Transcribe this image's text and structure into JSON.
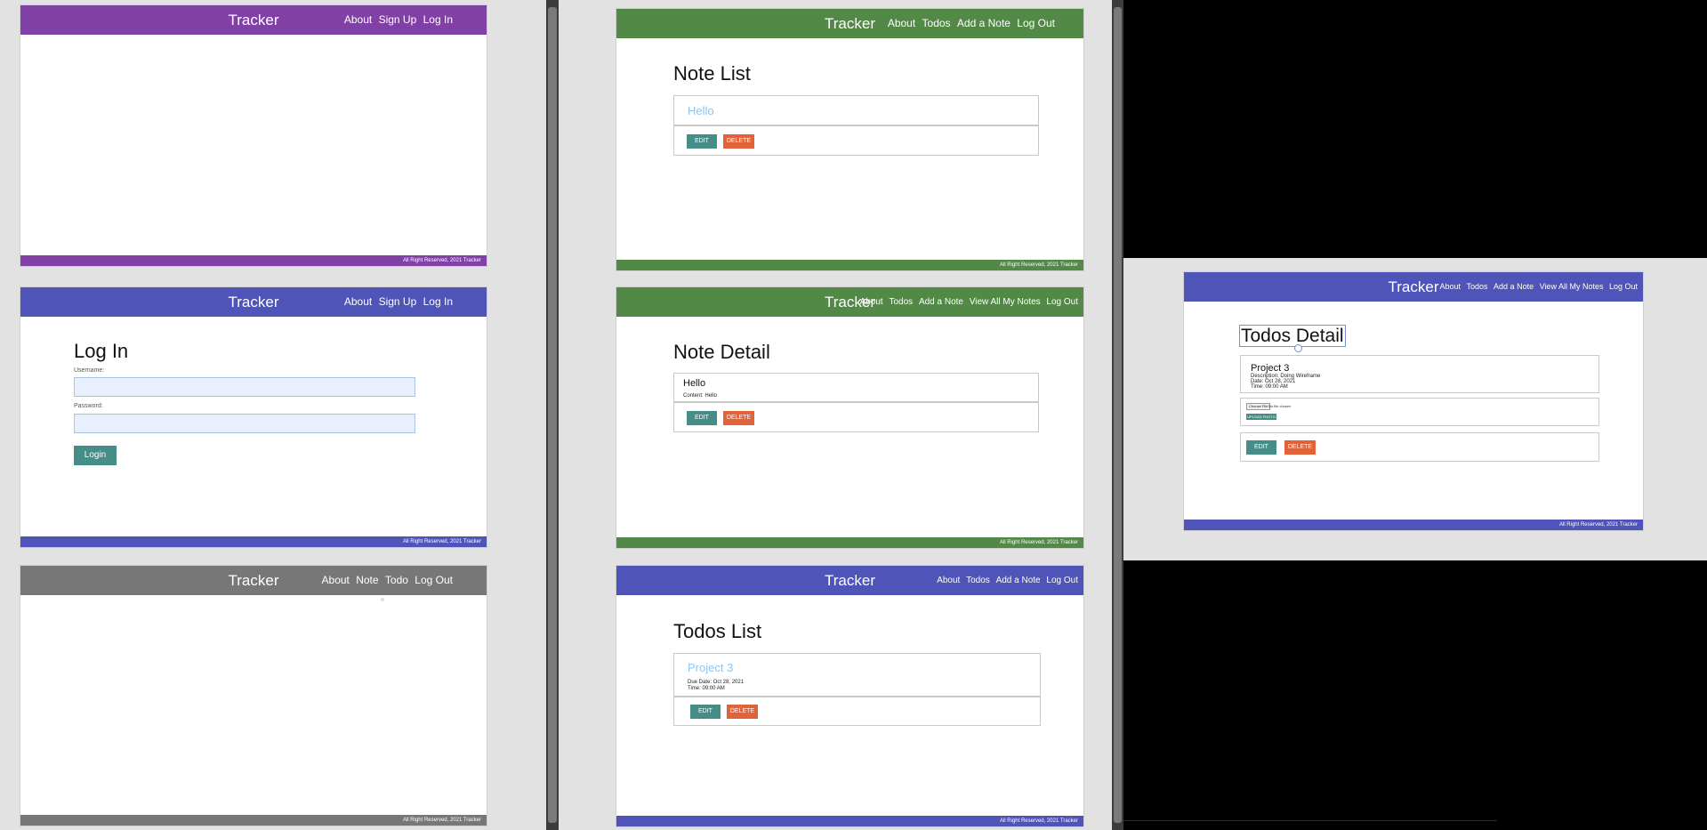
{
  "brand": "Tracker",
  "footer_text": "All Right Reserved, 2021 Tracker",
  "colors": {
    "purple": "#8140a5",
    "indigo": "#4e54b8",
    "gray": "#777777",
    "green": "#528947",
    "edit_button": "#468d87",
    "delete_button": "#e2623a",
    "link": "#8ec6ef"
  },
  "nav": {
    "guest": [
      "About",
      "Sign Up",
      "Log In"
    ],
    "member": [
      "About",
      "Note",
      "Todo",
      "Log Out"
    ],
    "notes": [
      "About",
      "Todos",
      "Add a Note",
      "Log Out"
    ],
    "note_detail": [
      "About",
      "Todos",
      "Add a Note",
      "View All My Notes",
      "Log Out"
    ],
    "todos": [
      "About",
      "Todos",
      "Add a Note",
      "Log Out"
    ],
    "todo_detail": [
      "About",
      "Todos",
      "Add a Note",
      "View All My Notes",
      "Log Out"
    ]
  },
  "login": {
    "title": "Log In",
    "username_label": "Username:",
    "password_label": "Password:",
    "button": "Login"
  },
  "note_list": {
    "title": "Note List",
    "item_title": "Hello",
    "edit": "EDIT",
    "delete": "DELETE"
  },
  "note_detail": {
    "title": "Note Detail",
    "note_title": "Hello",
    "content": "Content: Hello",
    "edit": "EDIT",
    "delete": "DELETE"
  },
  "todos_list": {
    "title": "Todos List",
    "item_title": "Project 3",
    "due_date": "Due Date: Oct 28, 2021",
    "time": "Time: 09:00 AM",
    "edit": "EDIT",
    "delete": "DELETE"
  },
  "todo_detail": {
    "title": "Todos Detail",
    "todo_title": "Project 3",
    "description": "Description: Doing Wireframe",
    "date": "Date: Oct 28, 2021",
    "time": "Time: 09:00 AM",
    "choose_file": "Choose File",
    "no_file": "No file chosen",
    "upload": "UPLOAD PHOTO",
    "edit": "EDIT",
    "delete": "DELETE"
  }
}
